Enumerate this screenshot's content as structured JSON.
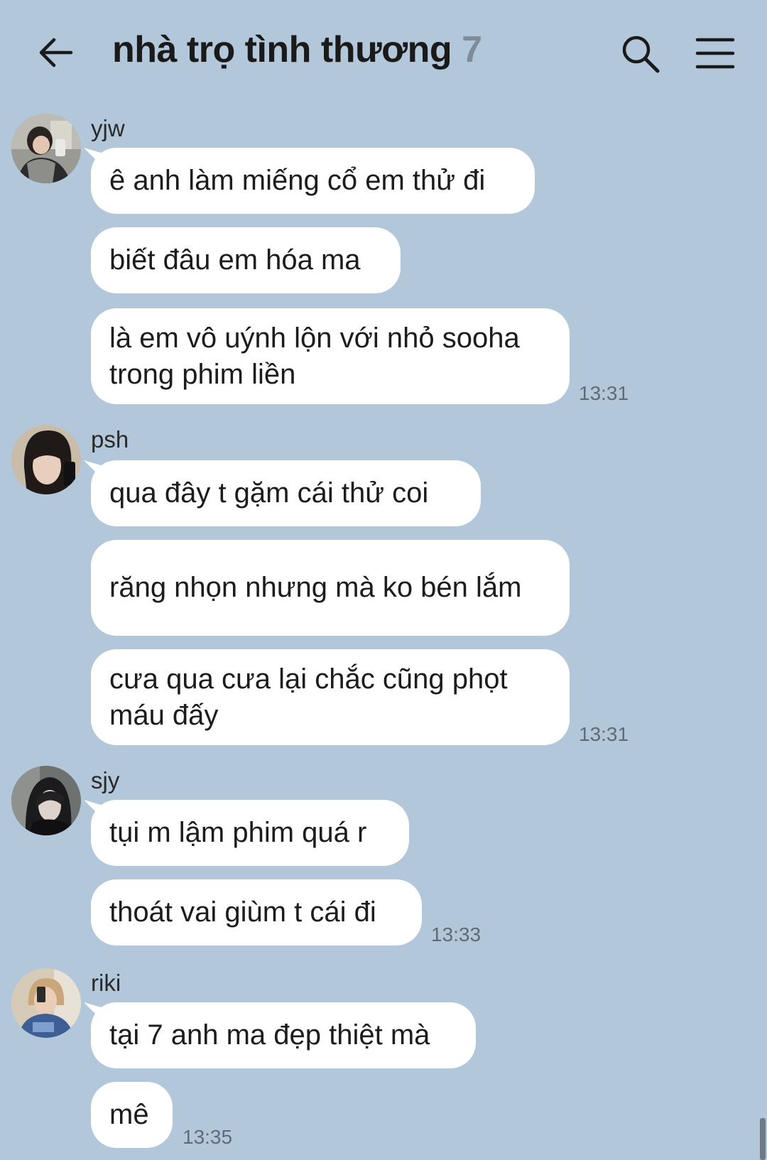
{
  "header": {
    "title": "nhà trọ tình thương",
    "member_count": "7",
    "back_icon": "arrow-left-icon",
    "search_icon": "search-icon",
    "menu_icon": "hamburger-menu-icon"
  },
  "colors": {
    "background": "#b3c7da",
    "bubble": "#ffffff",
    "member_count": "#7e8b99",
    "timestamp": "#5f6b78"
  },
  "messages": [
    {
      "sender": "yjw",
      "avatar_icon": "user-photo-avatar",
      "bubbles": [
        "ê anh làm miếng cổ em thử đi",
        "biết đâu em hóa ma",
        "là em vô uýnh lộn với nhỏ sooha trong phim liền"
      ],
      "time": "13:31"
    },
    {
      "sender": "psh",
      "avatar_icon": "user-photo-avatar",
      "bubbles": [
        "qua đây t gặm cái thử coi",
        "răng nhọn nhưng mà ko bén lắm",
        "cưa qua cưa lại chắc cũng phọt máu đấy"
      ],
      "time": "13:31"
    },
    {
      "sender": "sjy",
      "avatar_icon": "user-photo-avatar",
      "bubbles": [
        "tụi m lậm phim quá r",
        "thoát vai giùm t cái đi"
      ],
      "time": "13:33"
    },
    {
      "sender": "riki",
      "avatar_icon": "user-photo-avatar",
      "bubbles": [
        "tại 7 anh ma đẹp thiệt mà",
        "mê"
      ],
      "time": "13:35"
    }
  ]
}
